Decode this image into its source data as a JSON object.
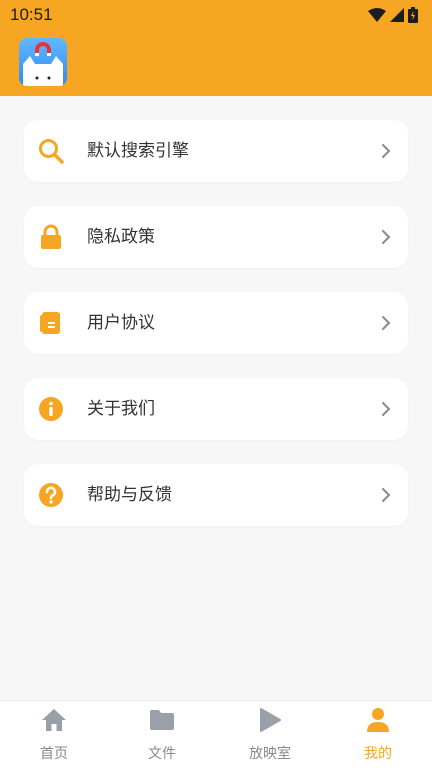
{
  "status_bar": {
    "time": "10:51"
  },
  "colors": {
    "accent": "#f6a623",
    "inactive": "#9aa0a9"
  },
  "menu": {
    "items": [
      {
        "label": "默认搜索引擎",
        "icon": "search-icon"
      },
      {
        "label": "隐私政策",
        "icon": "lock-icon"
      },
      {
        "label": "用户协议",
        "icon": "document-icon"
      },
      {
        "label": "关于我们",
        "icon": "info-icon"
      },
      {
        "label": "帮助与反馈",
        "icon": "help-icon"
      }
    ]
  },
  "tabbar": {
    "tabs": [
      {
        "label": "首页",
        "icon": "home-icon"
      },
      {
        "label": "文件",
        "icon": "folder-icon"
      },
      {
        "label": "放映室",
        "icon": "play-icon"
      },
      {
        "label": "我的",
        "icon": "person-icon",
        "active": true
      }
    ]
  }
}
